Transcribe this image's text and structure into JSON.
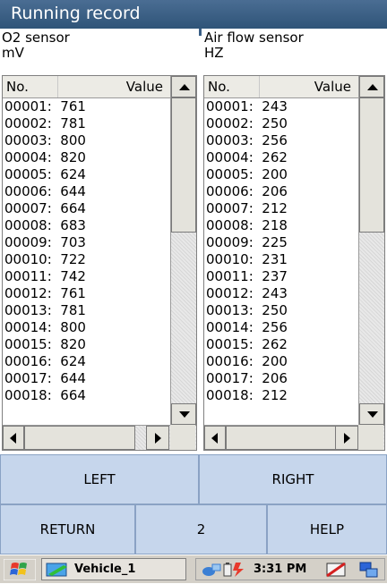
{
  "window": {
    "title": "Running record"
  },
  "left_panel": {
    "sensor_name": "O2 sensor",
    "unit": "mV",
    "columns": {
      "no": "No.",
      "value": "Value"
    },
    "rows": [
      "00001:  761",
      "00002:  781",
      "00003:  800",
      "00004:  820",
      "00005:  624",
      "00006:  644",
      "00007:  664",
      "00008:  683",
      "00009:  703",
      "00010:  722",
      "00011:  742",
      "00012:  761",
      "00013:  781",
      "00014:  800",
      "00015:  820",
      "00016:  624",
      "00017:  644",
      "00018:  664"
    ]
  },
  "right_panel": {
    "sensor_name": "Air flow sensor",
    "unit": "HZ",
    "columns": {
      "no": "No.",
      "value": "Value"
    },
    "rows": [
      "00001:  243",
      "00002:  250",
      "00003:  256",
      "00004:  262",
      "00005:  200",
      "00006:  206",
      "00007:  212",
      "00008:  218",
      "00009:  225",
      "00010:  231",
      "00011:  237",
      "00012:  243",
      "00013:  250",
      "00014:  256",
      "00015:  262",
      "00016:  200",
      "00017:  206",
      "00018:  212"
    ]
  },
  "buttons": {
    "left": "LEFT",
    "right": "RIGHT",
    "return": "RETURN",
    "page": "2",
    "help": "HELP"
  },
  "taskbar": {
    "task_label": "Vehicle_1",
    "clock": "3:31 PM",
    "icons": [
      "windows-start-icon",
      "vehicle-app-icon",
      "network-icon",
      "battery-icon",
      "no-sync-icon",
      "connection-icon"
    ]
  }
}
